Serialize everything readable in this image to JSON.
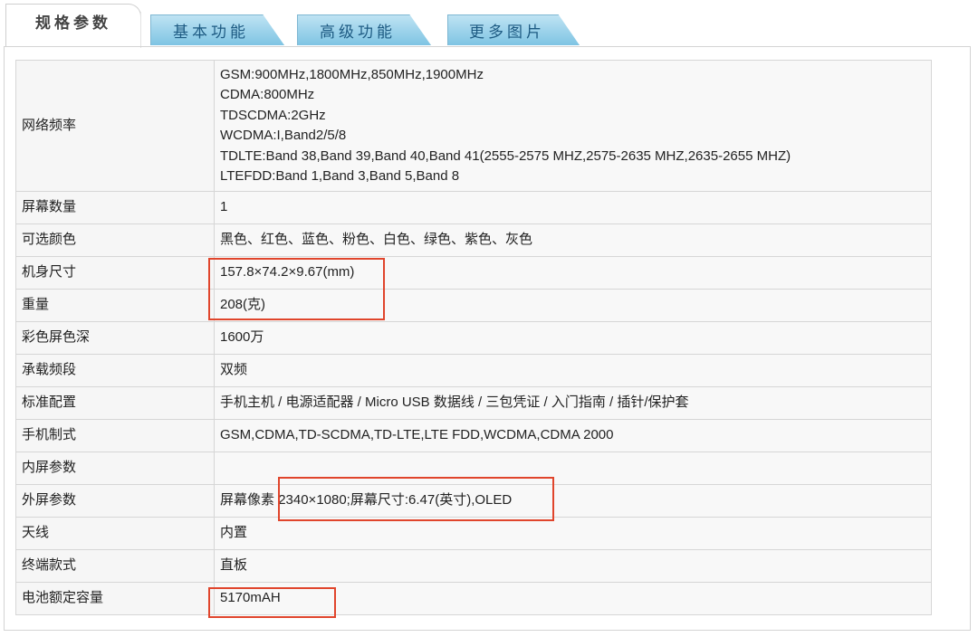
{
  "tabs": {
    "specs": "规格参数",
    "basic": "基本功能",
    "advanced": "高级功能",
    "more_images": "更多图片"
  },
  "specs": {
    "network": {
      "label": "网络频率",
      "lines": [
        "GSM:900MHz,1800MHz,850MHz,1900MHz",
        "CDMA:800MHz",
        "TDSCDMA:2GHz",
        "WCDMA:I,Band2/5/8",
        "TDLTE:Band 38,Band 39,Band 40,Band 41(2555-2575 MHZ,2575-2635 MHZ,2635-2655 MHZ)",
        "LTEFDD:Band 1,Band 3,Band 5,Band 8"
      ]
    },
    "screen_count": {
      "label": "屏幕数量",
      "value": "1"
    },
    "colors": {
      "label": "可选颜色",
      "value": "黑色、红色、蓝色、粉色、白色、绿色、紫色、灰色"
    },
    "dimensions": {
      "label": "机身尺寸",
      "value": "157.8×74.2×9.67(mm)"
    },
    "weight": {
      "label": "重量",
      "value": "208(克)"
    },
    "color_depth": {
      "label": "彩色屏色深",
      "value": "1600万"
    },
    "bands": {
      "label": "承载频段",
      "value": "双频"
    },
    "package": {
      "label": "标准配置",
      "value": "手机主机 / 电源适配器 / Micro USB 数据线 / 三包凭证 / 入门指南 / 插针/保护套"
    },
    "network_mode": {
      "label": "手机制式",
      "value": "GSM,CDMA,TD-SCDMA,TD-LTE,LTE FDD,WCDMA,CDMA 2000"
    },
    "inner_screen": {
      "label": "内屏参数",
      "value": ""
    },
    "outer_screen": {
      "label": "外屏参数",
      "prefix": "屏幕像素",
      "value": "2340×1080;屏幕尺寸:6.47(英寸),OLED"
    },
    "antenna": {
      "label": "天线",
      "value": "内置"
    },
    "form_factor": {
      "label": "终端款式",
      "value": "直板"
    },
    "battery": {
      "label": "电池额定容量",
      "value": "5170mAH"
    }
  },
  "highlight_color": "#e0452c"
}
